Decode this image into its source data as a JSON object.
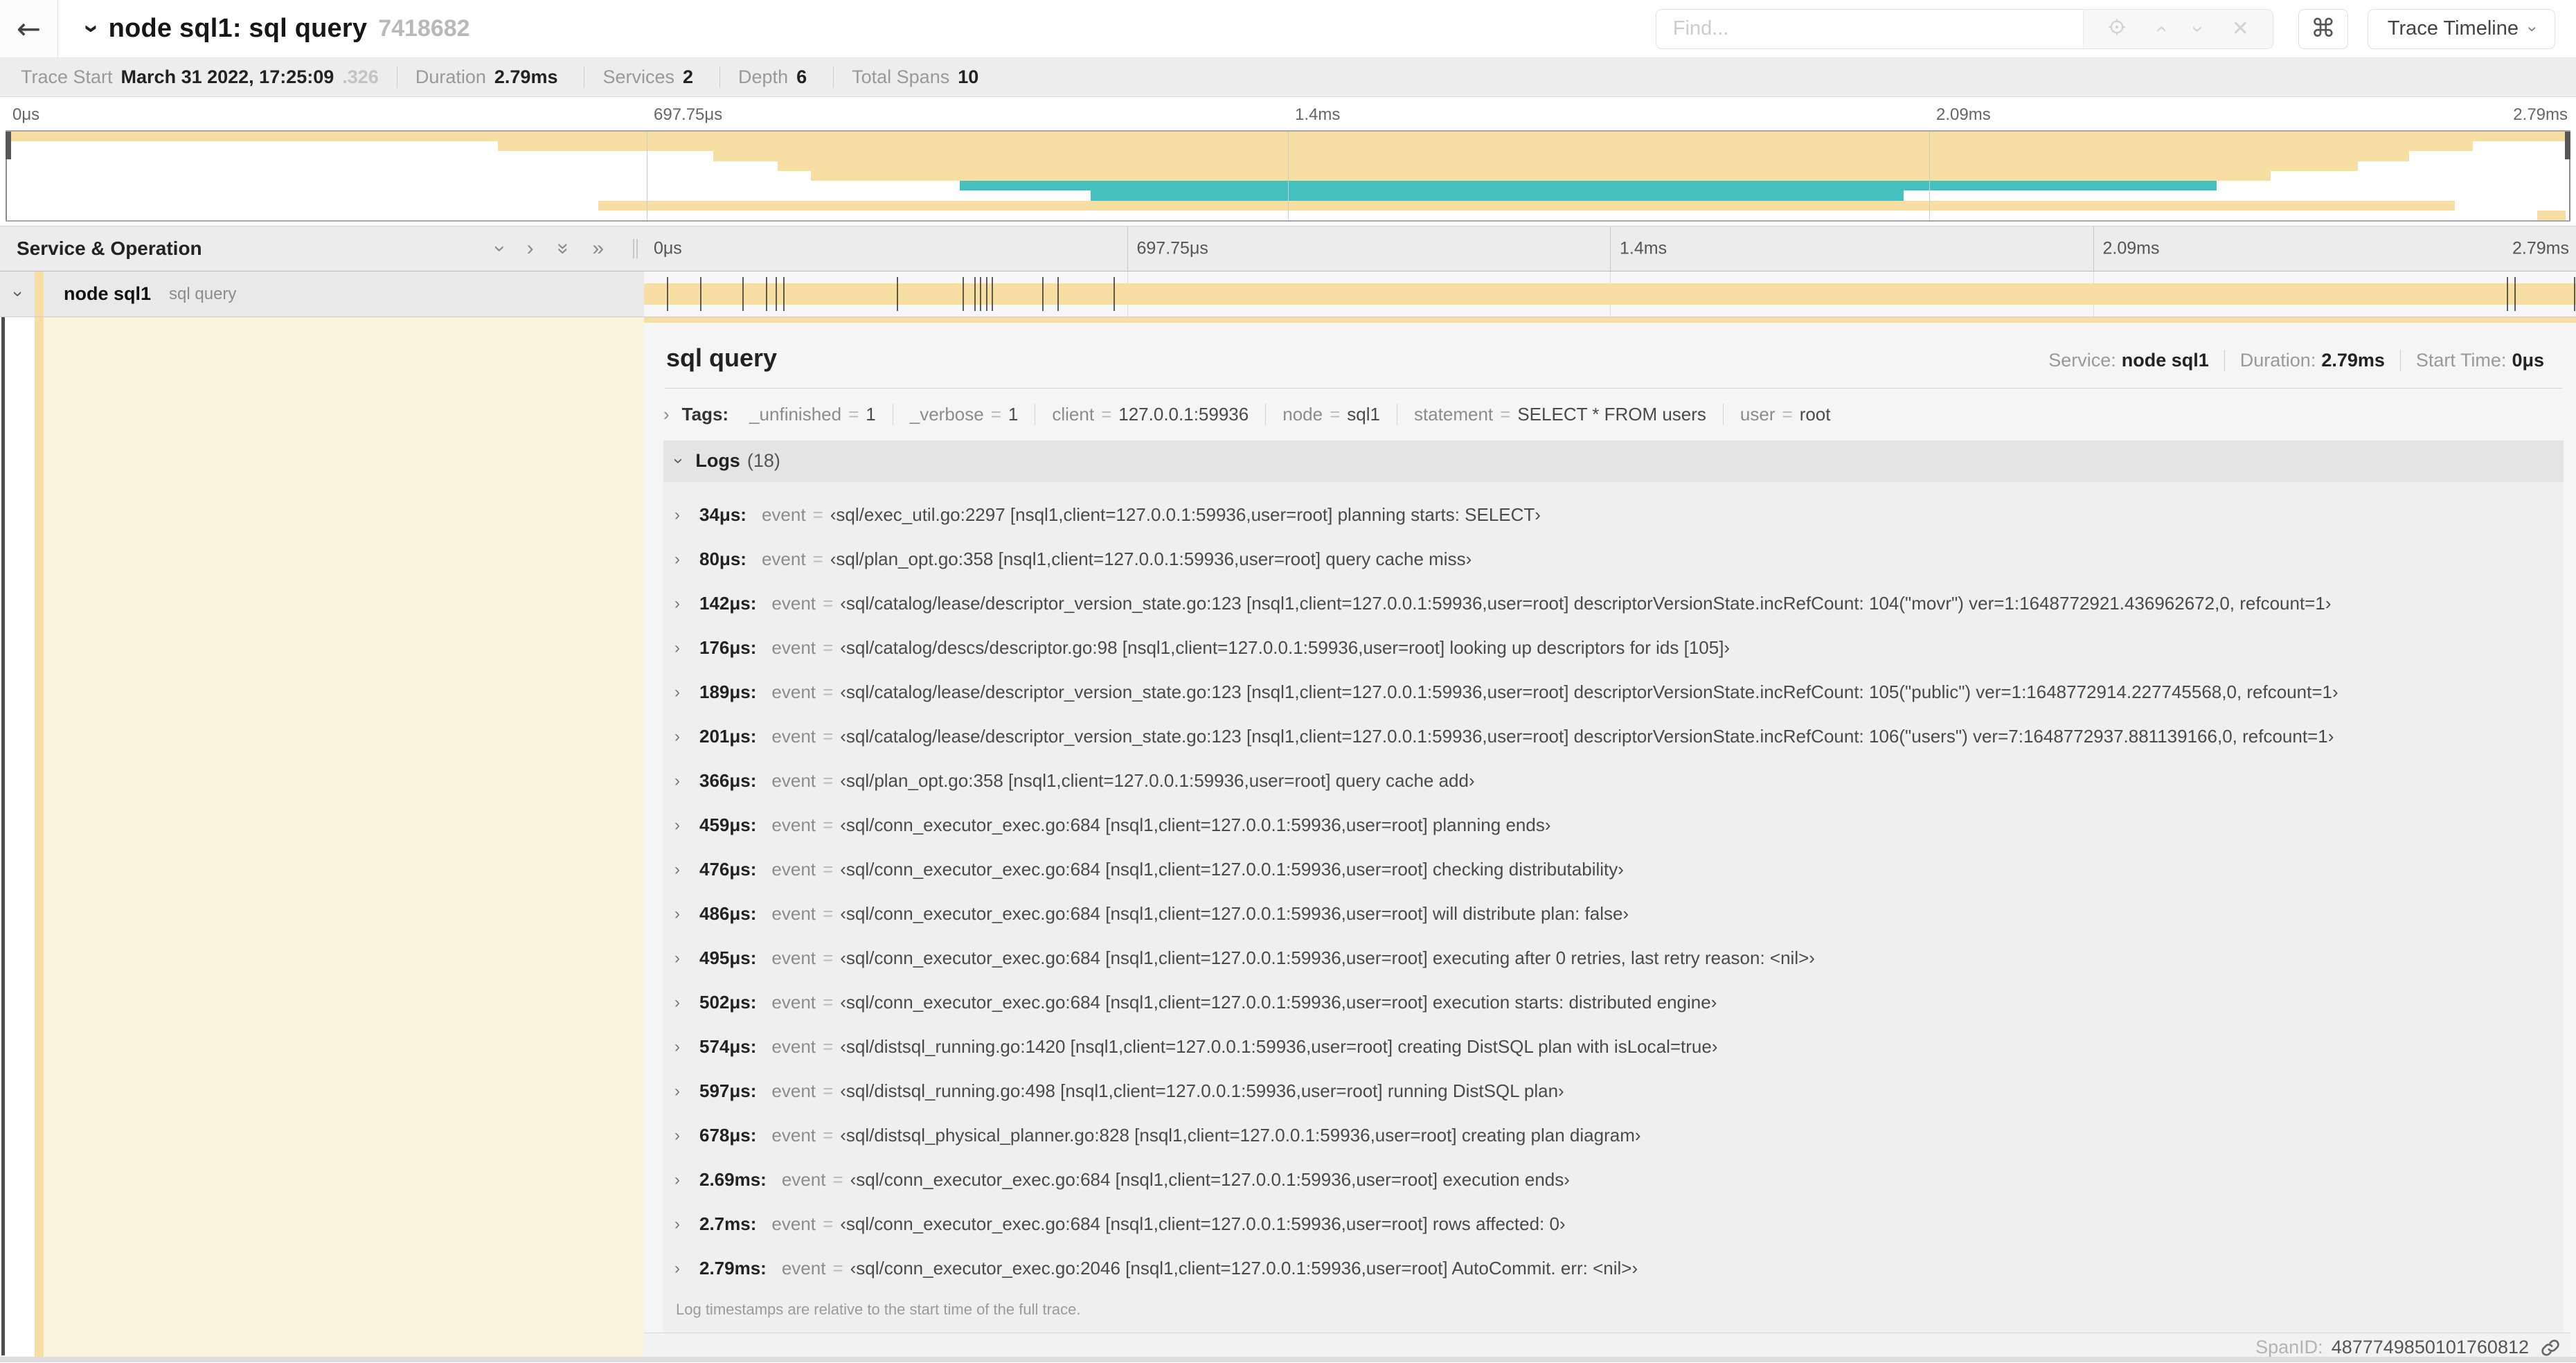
{
  "icons": {
    "back": "←",
    "chevron": "›",
    "dbl_chevron": "»",
    "close": "✕",
    "command": "⌘"
  },
  "header": {
    "title": "node sql1: sql query",
    "trace_id_short": "7418682",
    "find_placeholder": "Find...",
    "view_selector_label": "Trace Timeline"
  },
  "trace_summary": {
    "items": [
      {
        "label": "Trace Start",
        "value": "March 31 2022, 17:25:09",
        "suffix": ".326"
      },
      {
        "label": "Duration",
        "value": "2.79ms"
      },
      {
        "label": "Services",
        "value": "2"
      },
      {
        "label": "Depth",
        "value": "6"
      },
      {
        "label": "Total Spans",
        "value": "10"
      }
    ]
  },
  "minimap": {
    "ticks": [
      "0μs",
      "697.75μs",
      "1.4ms",
      "2.09ms",
      "2.79ms"
    ],
    "colors": {
      "tan": "#F7DFA4",
      "teal": "#46C0BE"
    },
    "bars": [
      {
        "row": 1,
        "start": 0,
        "end": 100,
        "color": "tan"
      },
      {
        "row": 2,
        "start": 19.2,
        "end": 96.2,
        "color": "tan"
      },
      {
        "row": 3,
        "start": 27.6,
        "end": 93.7,
        "color": "tan"
      },
      {
        "row": 4,
        "start": 30.1,
        "end": 91.7,
        "color": "tan"
      },
      {
        "row": 5,
        "start": 31.4,
        "end": 88.3,
        "color": "tan"
      },
      {
        "row": 6,
        "start": 37.2,
        "end": 86.2,
        "color": "teal"
      },
      {
        "row": 7,
        "start": 42.3,
        "end": 74.0,
        "color": "teal"
      },
      {
        "row": 8,
        "start": 23.1,
        "end": 95.5,
        "color": "tan"
      },
      {
        "row": 9,
        "start": 98.7,
        "end": 99.8,
        "color": "tan"
      }
    ]
  },
  "timeline": {
    "name_column_title": "Service & Operation",
    "ticks": [
      "0μs",
      "697.75μs",
      "1.4ms",
      "2.09ms",
      "2.79ms"
    ]
  },
  "span_row": {
    "service": "node sql1",
    "operation": "sql query",
    "bar_start_pct": 0,
    "bar_width_pct": 100,
    "log_marker_pcts": [
      1.2,
      2.9,
      5.1,
      6.3,
      6.8,
      7.2,
      13.1,
      16.5,
      17.1,
      17.4,
      17.7,
      18.0,
      20.6,
      21.4,
      24.3,
      96.4,
      96.8,
      99.9
    ]
  },
  "detail": {
    "operation": "sql query",
    "meta": [
      {
        "label": "Service:",
        "value": "node sql1"
      },
      {
        "label": "Duration:",
        "value": "2.79ms"
      },
      {
        "label": "Start Time:",
        "value": "0μs"
      }
    ],
    "tags_label": "Tags:",
    "tags": [
      {
        "key": "_unfinished",
        "value": "1"
      },
      {
        "key": "_verbose",
        "value": "1"
      },
      {
        "key": "client",
        "value": "127.0.0.1:59936"
      },
      {
        "key": "node",
        "value": "sql1"
      },
      {
        "key": "statement",
        "value": "SELECT * FROM users"
      },
      {
        "key": "user",
        "value": "root"
      }
    ],
    "eq": "=",
    "logs_label": "Logs",
    "logs_count": "(18)",
    "event_key": "event",
    "logs": [
      {
        "time": "34μs:",
        "value": "‹sql/exec_util.go:2297 [nsql1,client=127.0.0.1:59936,user=root] planning starts: SELECT›"
      },
      {
        "time": "80μs:",
        "value": "‹sql/plan_opt.go:358 [nsql1,client=127.0.0.1:59936,user=root] query cache miss›"
      },
      {
        "time": "142μs:",
        "value": "‹sql/catalog/lease/descriptor_version_state.go:123 [nsql1,client=127.0.0.1:59936,user=root] descriptorVersionState.incRefCount: 104(\"movr\") ver=1:1648772921.436962672,0, refcount=1›"
      },
      {
        "time": "176μs:",
        "value": "‹sql/catalog/descs/descriptor.go:98 [nsql1,client=127.0.0.1:59936,user=root] looking up descriptors for ids [105]›"
      },
      {
        "time": "189μs:",
        "value": "‹sql/catalog/lease/descriptor_version_state.go:123 [nsql1,client=127.0.0.1:59936,user=root] descriptorVersionState.incRefCount: 105(\"public\") ver=1:1648772914.227745568,0, refcount=1›"
      },
      {
        "time": "201μs:",
        "value": "‹sql/catalog/lease/descriptor_version_state.go:123 [nsql1,client=127.0.0.1:59936,user=root] descriptorVersionState.incRefCount: 106(\"users\") ver=7:1648772937.881139166,0, refcount=1›"
      },
      {
        "time": "366μs:",
        "value": "‹sql/plan_opt.go:358 [nsql1,client=127.0.0.1:59936,user=root] query cache add›"
      },
      {
        "time": "459μs:",
        "value": "‹sql/conn_executor_exec.go:684 [nsql1,client=127.0.0.1:59936,user=root] planning ends›"
      },
      {
        "time": "476μs:",
        "value": "‹sql/conn_executor_exec.go:684 [nsql1,client=127.0.0.1:59936,user=root] checking distributability›"
      },
      {
        "time": "486μs:",
        "value": "‹sql/conn_executor_exec.go:684 [nsql1,client=127.0.0.1:59936,user=root] will distribute plan: false›"
      },
      {
        "time": "495μs:",
        "value": "‹sql/conn_executor_exec.go:684 [nsql1,client=127.0.0.1:59936,user=root] executing after 0 retries, last retry reason: <nil>›"
      },
      {
        "time": "502μs:",
        "value": "‹sql/conn_executor_exec.go:684 [nsql1,client=127.0.0.1:59936,user=root] execution starts: distributed engine›"
      },
      {
        "time": "574μs:",
        "value": "‹sql/distsql_running.go:1420 [nsql1,client=127.0.0.1:59936,user=root] creating DistSQL plan with isLocal=true›"
      },
      {
        "time": "597μs:",
        "value": "‹sql/distsql_running.go:498 [nsql1,client=127.0.0.1:59936,user=root] running DistSQL plan›"
      },
      {
        "time": "678μs:",
        "value": "‹sql/distsql_physical_planner.go:828 [nsql1,client=127.0.0.1:59936,user=root] creating plan diagram›"
      },
      {
        "time": "2.69ms:",
        "value": "‹sql/conn_executor_exec.go:684 [nsql1,client=127.0.0.1:59936,user=root] execution ends›"
      },
      {
        "time": "2.7ms:",
        "value": "‹sql/conn_executor_exec.go:684 [nsql1,client=127.0.0.1:59936,user=root] rows affected: 0›"
      },
      {
        "time": "2.79ms:",
        "value": "‹sql/conn_executor_exec.go:2046 [nsql1,client=127.0.0.1:59936,user=root] AutoCommit. err: <nil>›"
      }
    ],
    "footer_note": "Log timestamps are relative to the start time of the full trace.",
    "span_id_label": "SpanID:",
    "span_id": "4877749850101760812"
  }
}
